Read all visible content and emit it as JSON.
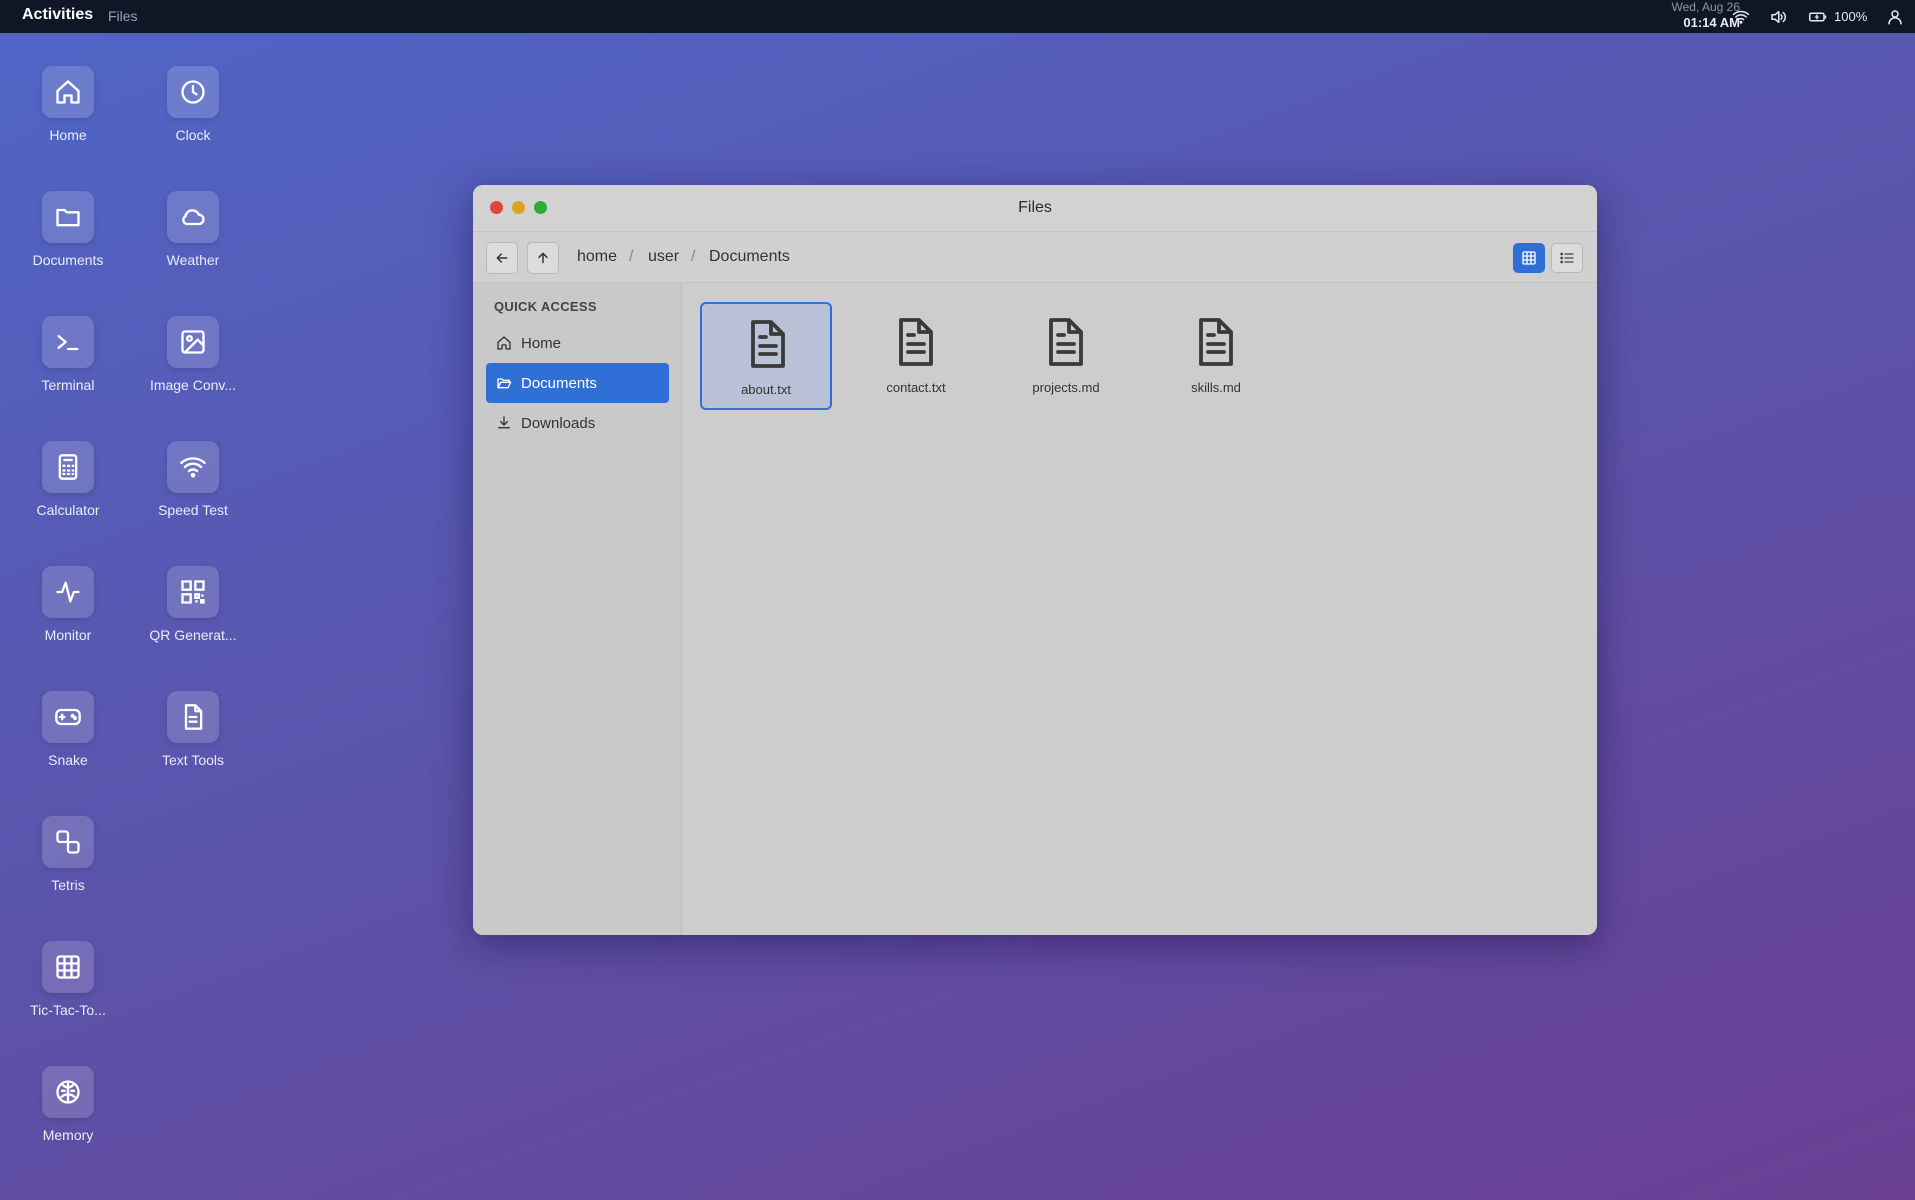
{
  "topbar": {
    "activities": "Activities",
    "app_name": "Files",
    "date": "Wed, Aug 26",
    "time": "01:14 AM",
    "battery": "100%",
    "icons": [
      "wifi-icon",
      "volume-icon",
      "battery-icon",
      "user-icon"
    ]
  },
  "desktop": {
    "icons": [
      {
        "label": "Home",
        "icon": "home-icon"
      },
      {
        "label": "Clock",
        "icon": "clock-icon"
      },
      {
        "label": "Documents",
        "icon": "folder-icon"
      },
      {
        "label": "Weather",
        "icon": "cloud-icon"
      },
      {
        "label": "Terminal",
        "icon": "terminal-icon"
      },
      {
        "label": "Image Conv...",
        "icon": "image-icon"
      },
      {
        "label": "Calculator",
        "icon": "calculator-icon"
      },
      {
        "label": "Speed Test",
        "icon": "wifi-icon"
      },
      {
        "label": "Monitor",
        "icon": "activity-icon"
      },
      {
        "label": "QR Generat...",
        "icon": "qr-code-icon"
      },
      {
        "label": "Snake",
        "icon": "gamepad-icon"
      },
      {
        "label": "Text Tools",
        "icon": "text-file-icon"
      },
      {
        "label": "Tetris",
        "icon": "shapes-icon"
      },
      {
        "label": "Tic-Tac-To...",
        "icon": "grid-icon"
      },
      {
        "label": "Memory",
        "icon": "brain-icon"
      }
    ]
  },
  "window": {
    "title": "Files",
    "breadcrumb": [
      "home",
      "user",
      "Documents"
    ],
    "breadcrumb_separator": "/",
    "view_mode": "grid",
    "sidebar": {
      "heading": "QUICK ACCESS",
      "items": [
        {
          "label": "Home",
          "icon": "home-icon",
          "active": false
        },
        {
          "label": "Documents",
          "icon": "folder-open-icon",
          "active": true
        },
        {
          "label": "Downloads",
          "icon": "download-icon",
          "active": false
        }
      ]
    },
    "files": [
      {
        "name": "about.txt",
        "selected": true
      },
      {
        "name": "contact.txt",
        "selected": false
      },
      {
        "name": "projects.md",
        "selected": false
      },
      {
        "name": "skills.md",
        "selected": false
      }
    ]
  },
  "colors": {
    "accent": "#2f6fd6",
    "topbar": "#0f1626",
    "window_bg": "#cdcdcd"
  }
}
